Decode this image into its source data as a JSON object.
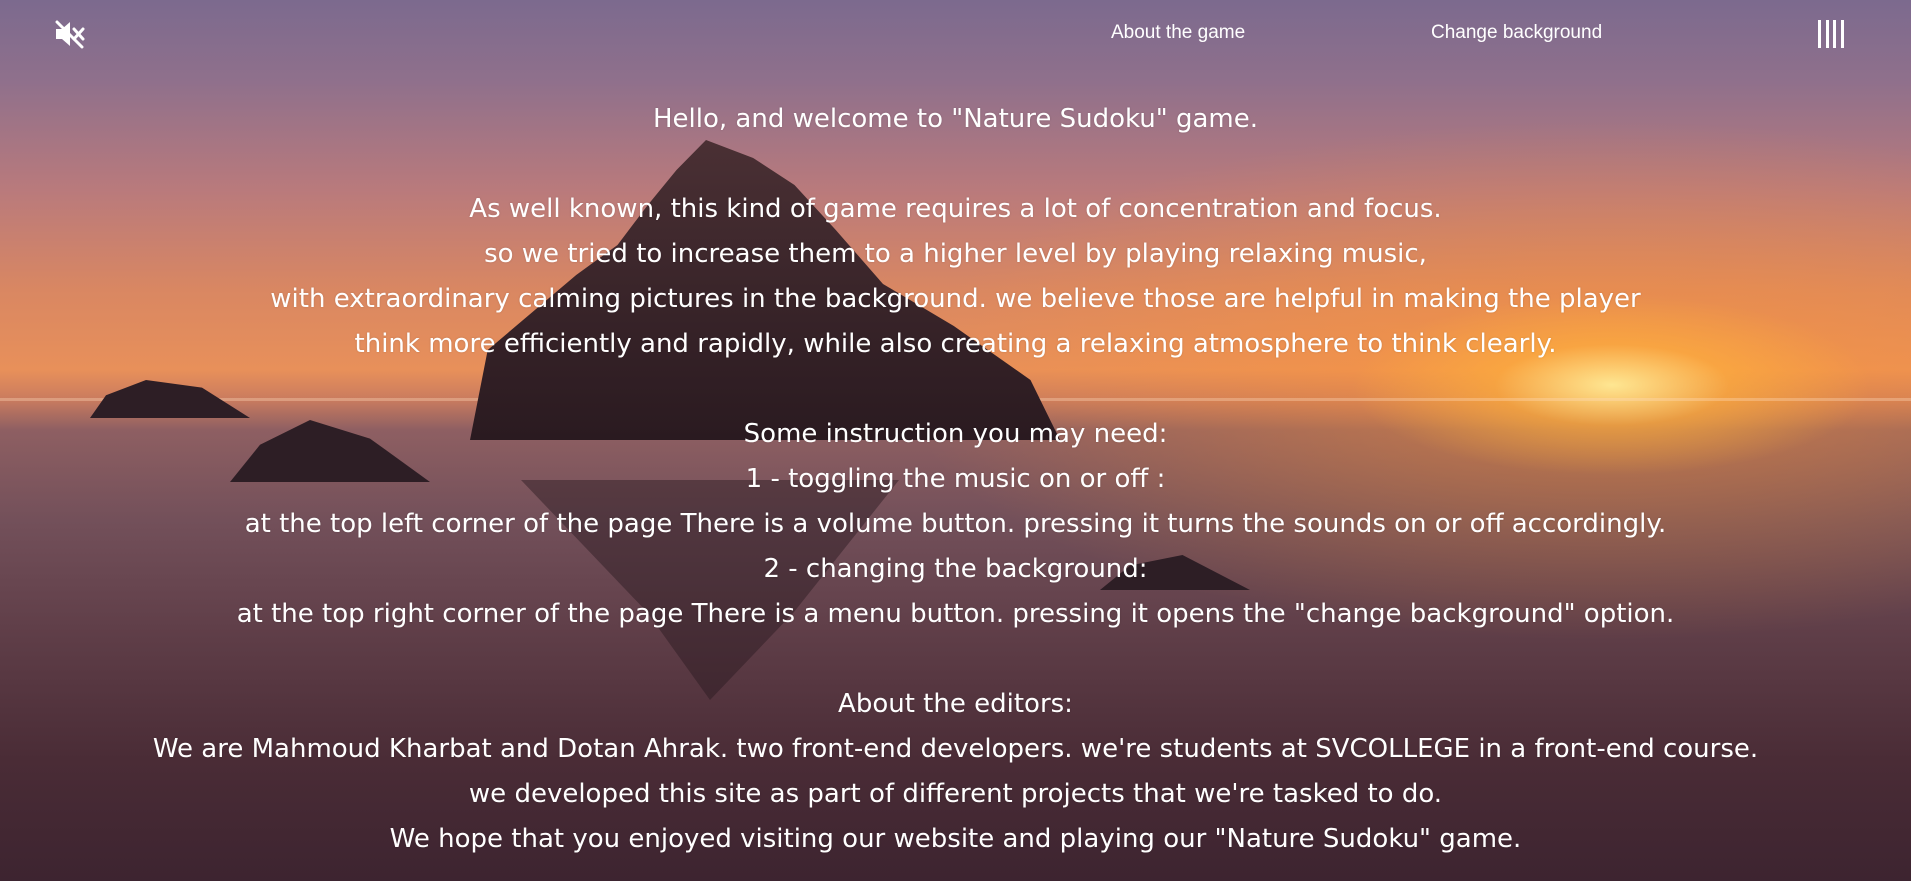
{
  "header": {
    "mute_icon": "volume-muted-icon",
    "about_label": "About the game",
    "change_background_label": "Change background",
    "menu_icon": "menu-bars-icon"
  },
  "content": {
    "welcome": "Hello, and welcome to \"Nature Sudoku\" game.",
    "intro": [
      "As well known, this kind of game requires a lot of concentration and focus.",
      "so we tried to increase them to a higher level by playing relaxing music,",
      "with extraordinary calming pictures in the background. we believe those are helpful in making the player",
      "think more efficiently and rapidly, while also creating a relaxing atmosphere to think clearly."
    ],
    "instructions_title": "Some instruction you may need:",
    "instructions": [
      "1 - toggling the music on or off :",
      "at the top left corner of the page There is a volume button. pressing it turns the sounds on or off accordingly.",
      "2 - changing the background:",
      "at the top right corner of the page There is a menu button. pressing it opens the \"change background\" option."
    ],
    "editors_title": "About the editors:",
    "editors": [
      "We are Mahmoud Kharbat and Dotan Ahrak. two front-end developers. we're students at SVCOLLEGE in a front-end course.",
      "we developed this site as part of different projects that we're tasked to do.",
      "We hope that you enjoyed visiting our website and playing our \"Nature Sudoku\" game."
    ]
  },
  "colors": {
    "text": "#ffffff",
    "sunset_orange": "#e8905a",
    "sky_purple": "#7c6a8e",
    "rock_dark": "#2d1e25"
  }
}
